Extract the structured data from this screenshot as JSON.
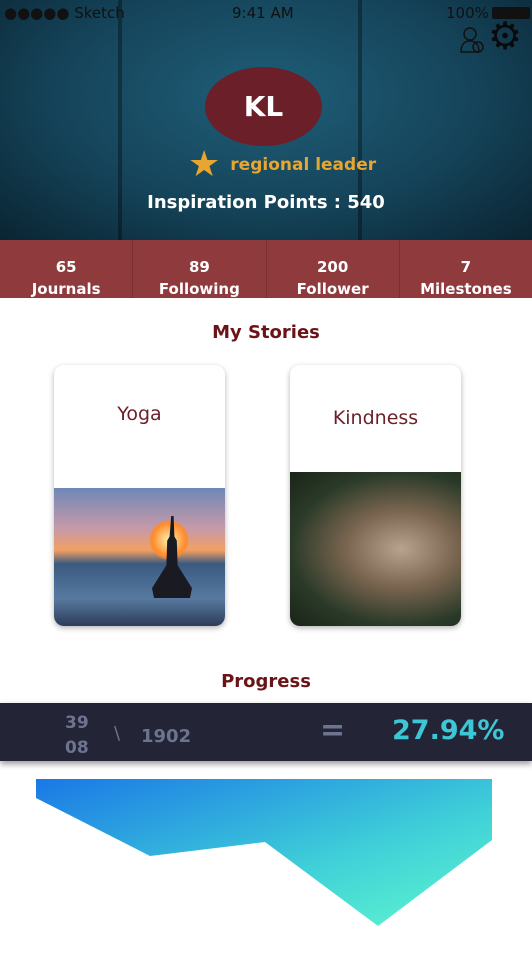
{
  "status": {
    "carrier": "●●●●● Sketch",
    "time": "9:41 AM",
    "battery": "100%"
  },
  "profile": {
    "initials": "KL",
    "rank": "regional leader",
    "points": "Inspiration Points : 540"
  },
  "stats": [
    {
      "value": "65",
      "label": "Journals"
    },
    {
      "value": "89",
      "label": "Following"
    },
    {
      "value": "200",
      "label": "Follower"
    },
    {
      "value": "7",
      "label": "Milestones"
    }
  ],
  "stories": {
    "title": "My Stories",
    "items": [
      {
        "title": "Yoga"
      },
      {
        "title": "Kindness"
      }
    ]
  },
  "progress": {
    "title": "Progress",
    "numerator_top": "39",
    "numerator_bottom": "08",
    "separator": "\\",
    "total": "1902",
    "equals": "=",
    "percent": "27.94%",
    "percent_color": "#3cc6d6"
  }
}
